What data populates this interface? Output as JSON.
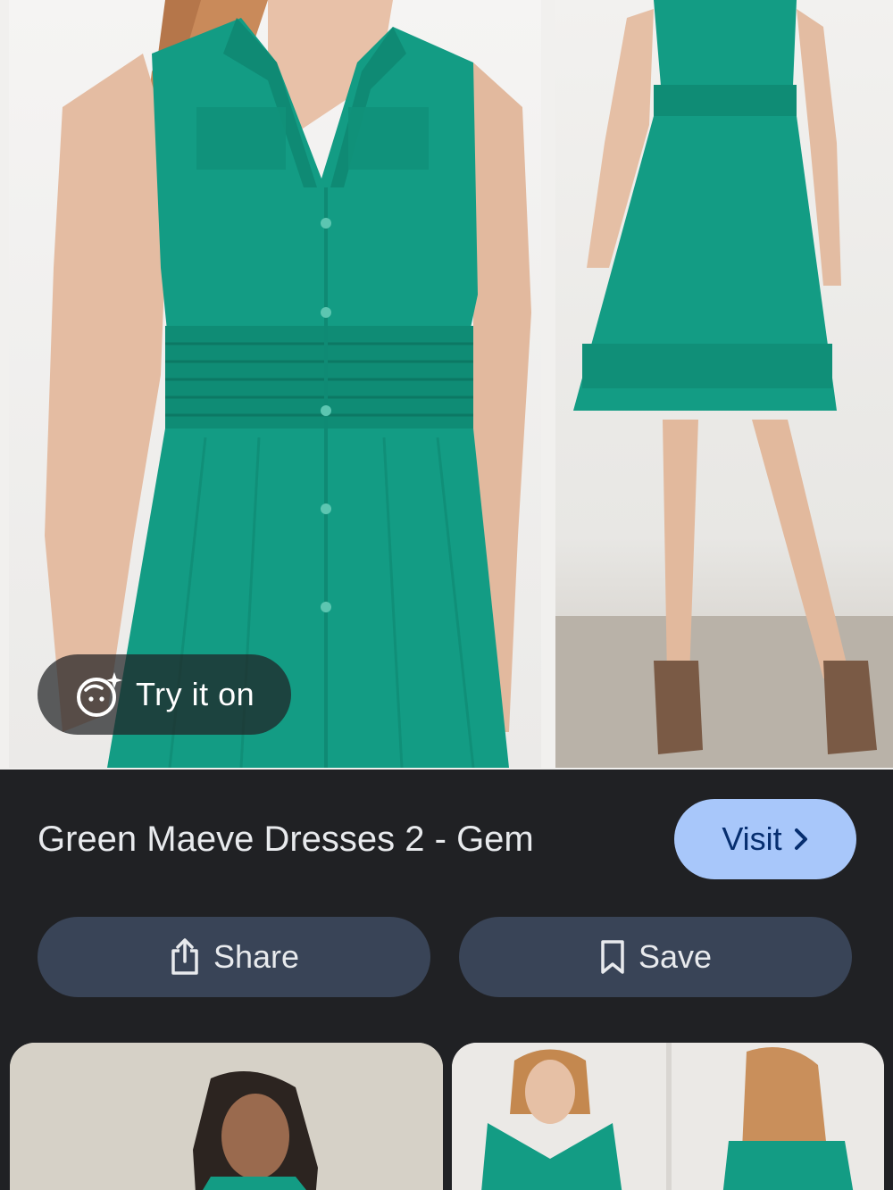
{
  "preview": {
    "try_on_label": "Try it on",
    "try_on_icon": "face-sparkle-icon"
  },
  "result": {
    "title": "Green Maeve Dresses 2 - Gem",
    "visit_label": "Visit"
  },
  "actions": {
    "share_label": "Share",
    "save_label": "Save"
  },
  "colors": {
    "background": "#202124",
    "visit_button": "#a8c7fa",
    "action_button": "#394457",
    "dress_green": "#139c84"
  }
}
